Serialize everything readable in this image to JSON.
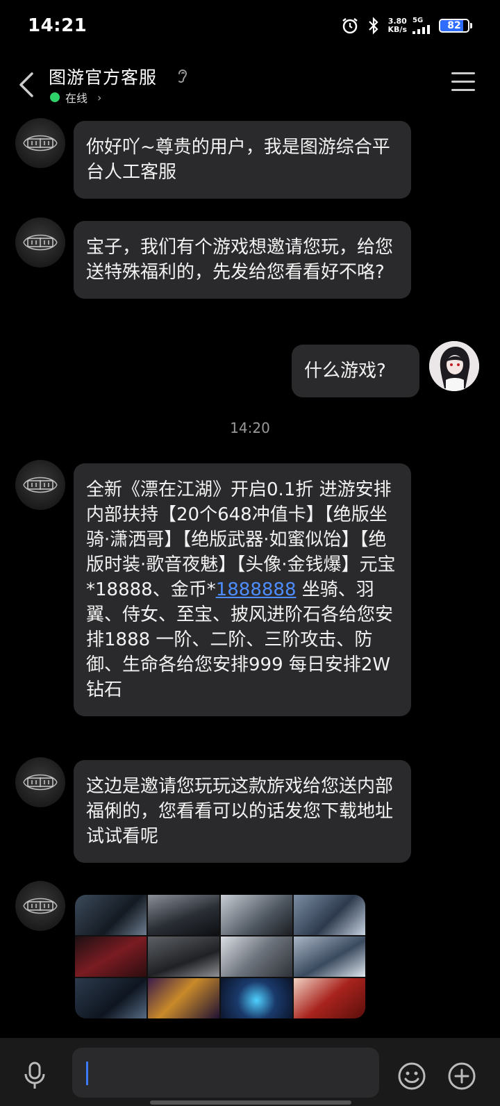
{
  "status_bar": {
    "time": "14:21",
    "net_speed_value": "3.80",
    "net_speed_unit": "KB/s",
    "network_type": "5G",
    "battery": "82",
    "battery_level_percent": 82,
    "icons": [
      "alarm-icon",
      "bluetooth-icon",
      "signal-icon",
      "battery-icon"
    ]
  },
  "header": {
    "title": "图游官方客服",
    "status": "在线",
    "status_color": "#2fd16b"
  },
  "messages": [
    {
      "from": "agent",
      "text": "你好吖~尊贵的用户，我是图游综合平台人工客服"
    },
    {
      "from": "agent",
      "text": "宝子，我们有个游戏想邀请您玩，给您送特殊福利的，先发给您看看好不咯?"
    },
    {
      "from": "user",
      "text": "什么游戏?"
    },
    {
      "from": "timestamp",
      "text": "14:20"
    },
    {
      "from": "agent",
      "text_before_link": "全新《漂在江湖》开启0.1折 进游安排内部扶持【20个648冲值卡】【绝版坐骑·潇洒哥】【绝版武器·如蜜似饴】【绝版时装·歌音夜魅】【头像·金钱爆】元宝*18888、金币*",
      "link": "1888888",
      "text_after_link": " 坐骑、羽翼、侍女、至宝、披风进阶石各给您安排1888 一阶、二阶、三阶攻击、防御、生命各给您安排999 每日安排2W钻石"
    },
    {
      "from": "agent",
      "text": "这边是邀请您玩玩这款旂戏给您送内部福俐的，您看看可以的话发您下载地址试试看呢"
    },
    {
      "from": "agent",
      "type": "image",
      "thumb_count": 12
    }
  ],
  "bottom_bar": {
    "input_value": "",
    "icons": [
      "microphone-icon",
      "emoji-icon",
      "plus-icon"
    ],
    "caret_color": "#3c7bff"
  },
  "colors": {
    "background": "#000000",
    "bubble": "#2a2a2c",
    "link": "#4d8dff",
    "accent": "#2f6dff"
  }
}
